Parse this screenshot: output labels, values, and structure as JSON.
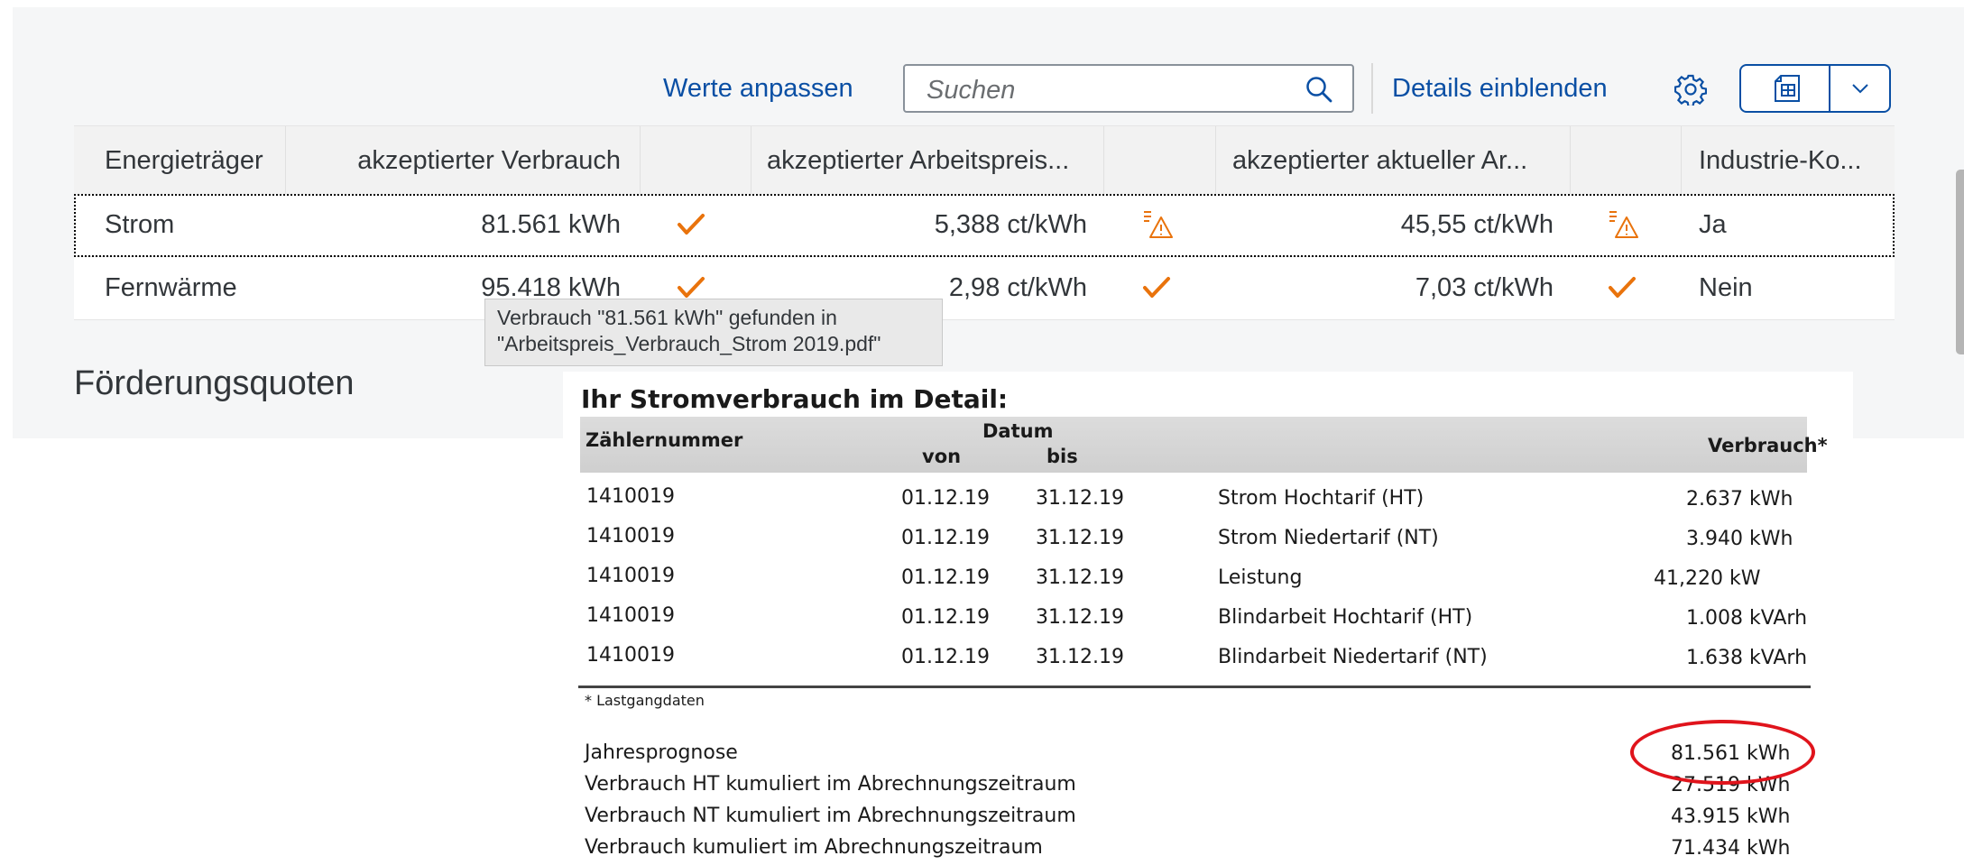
{
  "toolbar": {
    "adjust_values": "Werte anpassen",
    "search_placeholder": "Suchen",
    "show_details": "Details einblenden"
  },
  "table": {
    "headers": [
      "Energieträger",
      "akzeptierter Verbrauch",
      "akzeptierter Arbeitspreis...",
      "akzeptierter aktueller Ar...",
      "Industrie-Ko..."
    ],
    "rows": [
      {
        "carrier": "Strom",
        "consumption": "81.561 kWh",
        "consumption_status": "check",
        "price": "5,388 ct/kWh",
        "price_status": "warning",
        "current_price": "45,55 ct/kWh",
        "current_status": "warning",
        "industry": "Ja"
      },
      {
        "carrier": "Fernwärme",
        "consumption": "95.418 kWh",
        "consumption_status": "check",
        "price": "2,98 ct/kWh",
        "price_status": "check",
        "current_price": "7,03 ct/kWh",
        "current_status": "check",
        "industry": "Nein"
      }
    ]
  },
  "tooltip": {
    "line1": "Verbrauch \"81.561 kWh\" gefunden in",
    "line2": "\"Arbeitspreis_Verbrauch_Strom 2019.pdf\""
  },
  "section_title": "Förderungsquoten",
  "document": {
    "title": "Ihr Stromverbrauch im Detail:",
    "headers": {
      "meter": "Zählernummer",
      "date": "Datum",
      "from": "von",
      "to": "bis",
      "consumption": "Verbrauch*"
    },
    "rows": [
      {
        "meter": "1410019",
        "from": "01.12.19",
        "to": "31.12.19",
        "label": "Strom Hochtarif (HT)",
        "value": "2.637 kWh"
      },
      {
        "meter": "1410019",
        "from": "01.12.19",
        "to": "31.12.19",
        "label": "Strom Niedertarif (NT)",
        "value": "3.940 kWh"
      },
      {
        "meter": "1410019",
        "from": "01.12.19",
        "to": "31.12.19",
        "label": "Leistung",
        "value": "41,220 kW"
      },
      {
        "meter": "1410019",
        "from": "01.12.19",
        "to": "31.12.19",
        "label": "Blindarbeit Hochtarif (HT)",
        "value": "1.008 kVArh"
      },
      {
        "meter": "1410019",
        "from": "01.12.19",
        "to": "31.12.19",
        "label": "Blindarbeit Niedertarif (NT)",
        "value": "1.638 kVArh"
      }
    ],
    "footnote": "* Lastgangdaten",
    "summary": [
      {
        "label": "Jahresprognose",
        "value": "81.561 kWh"
      },
      {
        "label": "Verbrauch HT kumuliert im Abrechnungszeitraum",
        "value": "27.519 kWh"
      },
      {
        "label": "Verbrauch NT kumuliert im Abrechnungszeitraum",
        "value": "43.915 kWh"
      },
      {
        "label": "Verbrauch kumuliert im Abrechnungszeitraum",
        "value": "71.434 kWh"
      }
    ]
  },
  "colors": {
    "accent": "#0a4fa4",
    "check": "#e9730c",
    "highlight_oval": "#e0141c"
  },
  "icons": [
    "search-icon",
    "gear-icon",
    "spreadsheet-export-icon",
    "chevron-down-icon",
    "checkmark-icon",
    "warning-icon"
  ]
}
